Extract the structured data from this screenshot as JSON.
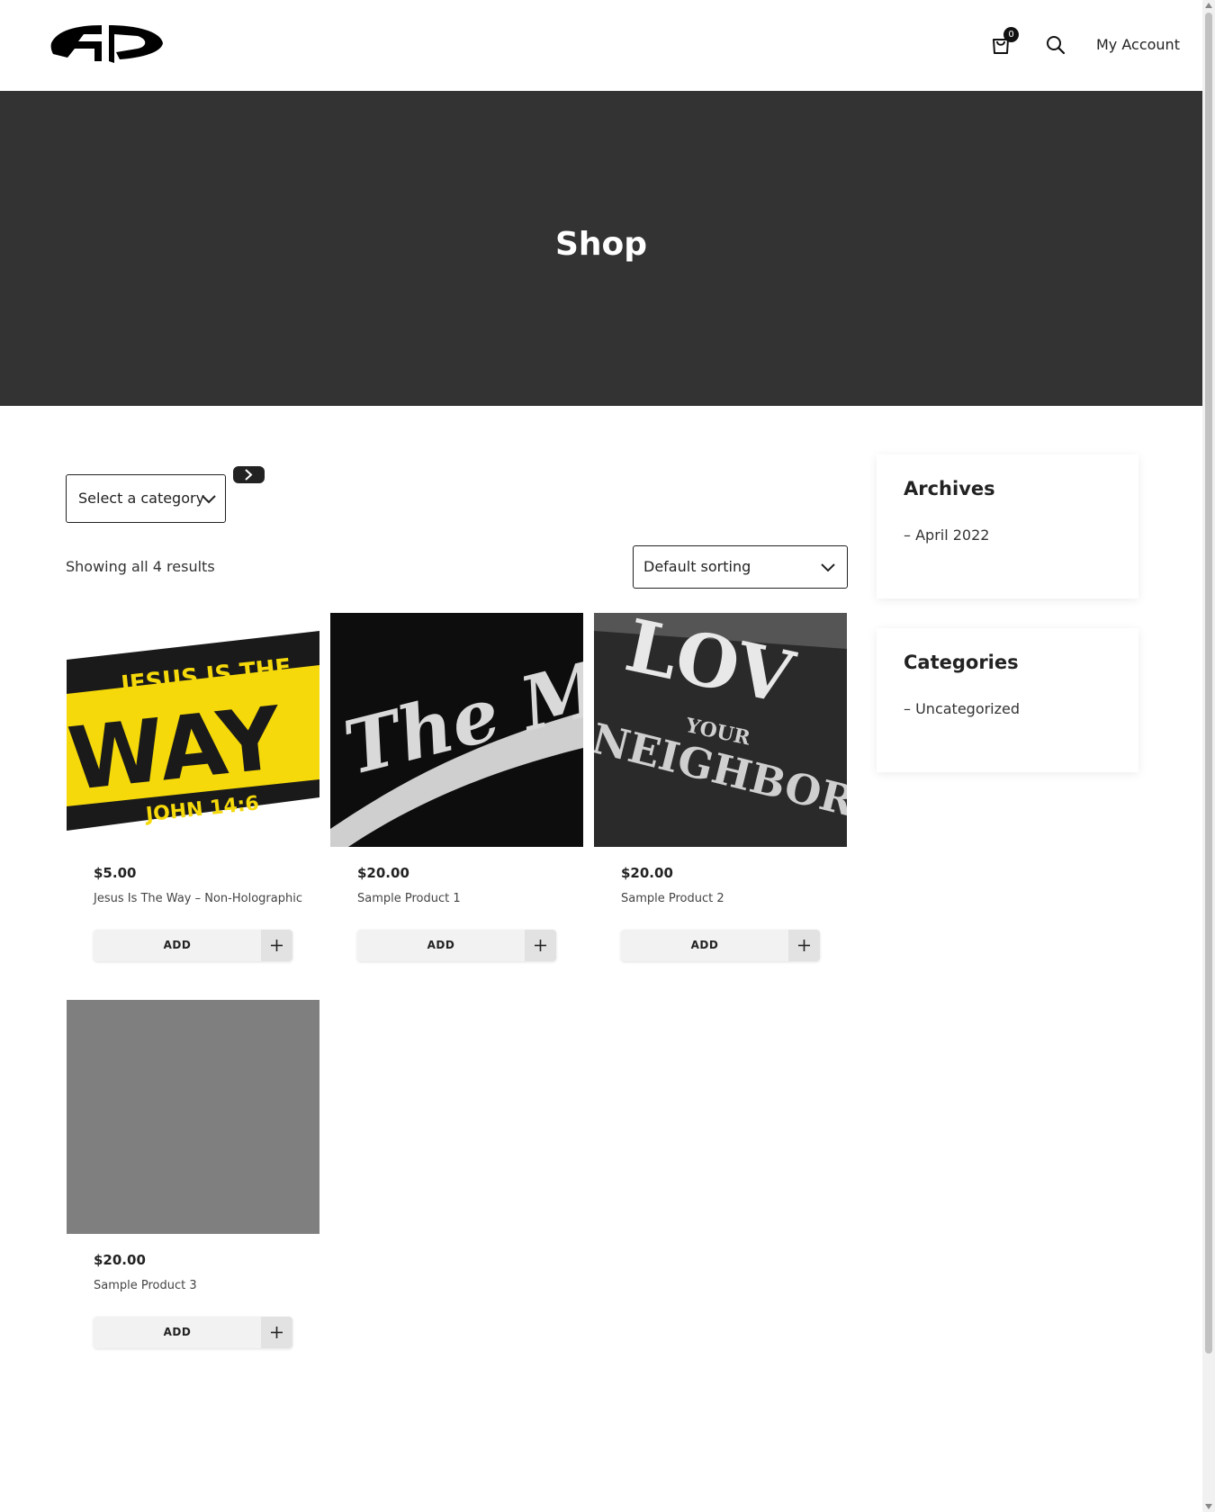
{
  "header": {
    "cart_count": "0",
    "account_label": "My Account"
  },
  "hero": {
    "title": "Shop"
  },
  "filters": {
    "category_select": "Select a category",
    "sort_select": "Default sorting",
    "results_text": "Showing all 4 results"
  },
  "products": [
    {
      "price": "$5.00",
      "title": "Jesus Is The Way – Non-Holographic",
      "add_label": "ADD"
    },
    {
      "price": "$20.00",
      "title": "Sample Product 1",
      "add_label": "ADD"
    },
    {
      "price": "$20.00",
      "title": "Sample Product 2",
      "add_label": "ADD"
    },
    {
      "price": "$20.00",
      "title": "Sample Product 3",
      "add_label": "ADD"
    }
  ],
  "sidebar": {
    "archives": {
      "title": "Archives",
      "items": [
        "– April 2022"
      ]
    },
    "categories": {
      "title": "Categories",
      "items": [
        "– Uncategorized"
      ]
    }
  },
  "product_images": {
    "p1_text_top": "JESUS IS THE",
    "p1_text_main": "WAY",
    "p1_text_bottom": "JOHN 14:6",
    "p2_text": "The M",
    "p3_text_top": "LOV",
    "p3_text_mid": "YOUR",
    "p3_text_bot": "NEIGHBOR"
  },
  "colors": {
    "hero_bg": "#333333",
    "accent_yellow": "#f5d90a",
    "placeholder_gray": "#7f7f7f"
  }
}
